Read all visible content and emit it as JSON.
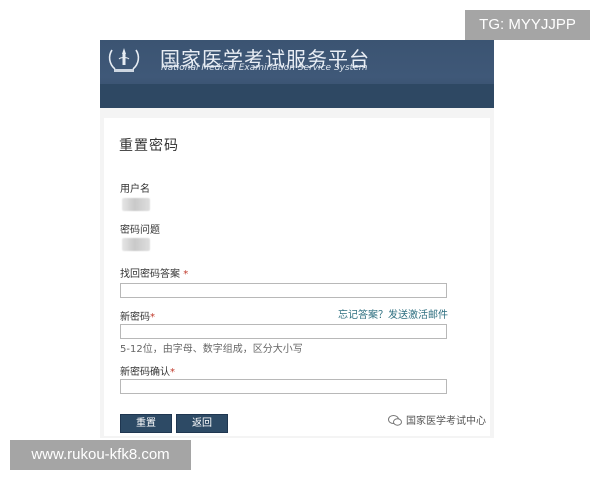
{
  "banner": {
    "title_cn": "国家医学考试服务平台",
    "title_en": "National Medical Examination Service System"
  },
  "form": {
    "title": "重置密码",
    "username_label": "用户名",
    "question_label": "密码问题",
    "answer_label": "找回密码答案",
    "answer_required": "*",
    "forgot_link": "忘记答案？发送激活邮件",
    "new_password_label": "新密码",
    "new_password_required": "*",
    "password_hint": "5-12位，由字母、数字组成，区分大小写",
    "confirm_label": "新密码确认",
    "confirm_required": "*",
    "answer_value": "",
    "new_password_value": "",
    "confirm_value": "",
    "reset_button": "重置",
    "back_button": "返回"
  },
  "watermarks": {
    "wechat_source": "国家医学考试中心",
    "tg_badge": "TG: MYYJJPP",
    "url_badge": "www.rukou-kfk8.com"
  },
  "icons": [
    "national-emblem-icon",
    "wechat-icon"
  ],
  "colors": {
    "banner": "#3b5472",
    "button": "#2d4a65",
    "link": "#2c6e7f",
    "required": "#c0392b",
    "badge": "#a5a5a5"
  }
}
